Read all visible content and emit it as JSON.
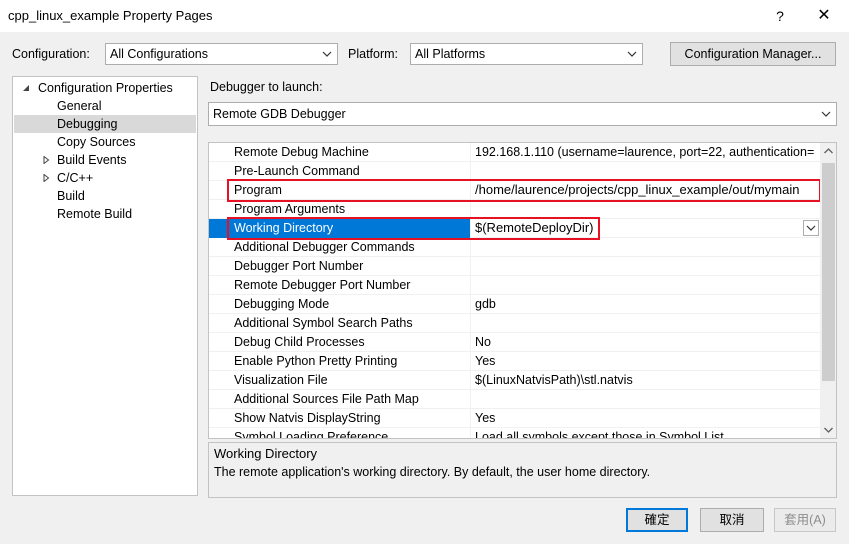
{
  "window": {
    "title": "cpp_linux_example Property Pages",
    "help_glyph": "?",
    "close_glyph": "✕"
  },
  "toolbar": {
    "configuration_label": "Configuration:",
    "configuration_value": "All Configurations",
    "platform_label": "Platform:",
    "platform_value": "All Platforms",
    "config_manager_label": "Configuration Manager..."
  },
  "tree": {
    "items": [
      {
        "label": "Configuration Properties",
        "expander": "expanded"
      },
      {
        "label": "General"
      },
      {
        "label": "Debugging",
        "selected": true
      },
      {
        "label": "Copy Sources"
      },
      {
        "label": "Build Events",
        "expander": "collapsed"
      },
      {
        "label": "C/C++",
        "expander": "collapsed"
      },
      {
        "label": "Build"
      },
      {
        "label": "Remote Build"
      }
    ]
  },
  "debugger": {
    "launch_label": "Debugger to launch:",
    "launch_value": "Remote GDB Debugger"
  },
  "grid": {
    "rows": [
      {
        "name": "Remote Debug Machine",
        "value": "192.168.1.110 (username=laurence, port=22, authentication="
      },
      {
        "name": "Pre-Launch Command",
        "value": ""
      },
      {
        "name": "Program",
        "value": "/home/laurence/projects/cpp_linux_example/out/mymain"
      },
      {
        "name": "Program Arguments",
        "value": ""
      },
      {
        "name": "Working Directory",
        "value": "$(RemoteDeployDir)"
      },
      {
        "name": "Additional Debugger Commands",
        "value": ""
      },
      {
        "name": "Debugger Port Number",
        "value": ""
      },
      {
        "name": "Remote Debugger Port Number",
        "value": ""
      },
      {
        "name": "Debugging Mode",
        "value": "gdb"
      },
      {
        "name": "Additional Symbol Search Paths",
        "value": ""
      },
      {
        "name": "Debug Child Processes",
        "value": "No"
      },
      {
        "name": "Enable Python Pretty Printing",
        "value": "Yes"
      },
      {
        "name": "Visualization File",
        "value": "$(LinuxNatvisPath)\\stl.natvis"
      },
      {
        "name": "Additional Sources File Path Map",
        "value": ""
      },
      {
        "name": "Show Natvis DisplayString",
        "value": "Yes"
      },
      {
        "name": "Symbol Loading Preference",
        "value": "Load all symbols except those in Symbol List"
      }
    ]
  },
  "description": {
    "title": "Working Directory",
    "text": "The remote application's working directory. By default, the user home directory."
  },
  "buttons": {
    "ok": "確定",
    "cancel": "取消",
    "apply": "套用(A)"
  },
  "colors": {
    "selection": "#0078d7",
    "highlight_box": "#e81123"
  }
}
